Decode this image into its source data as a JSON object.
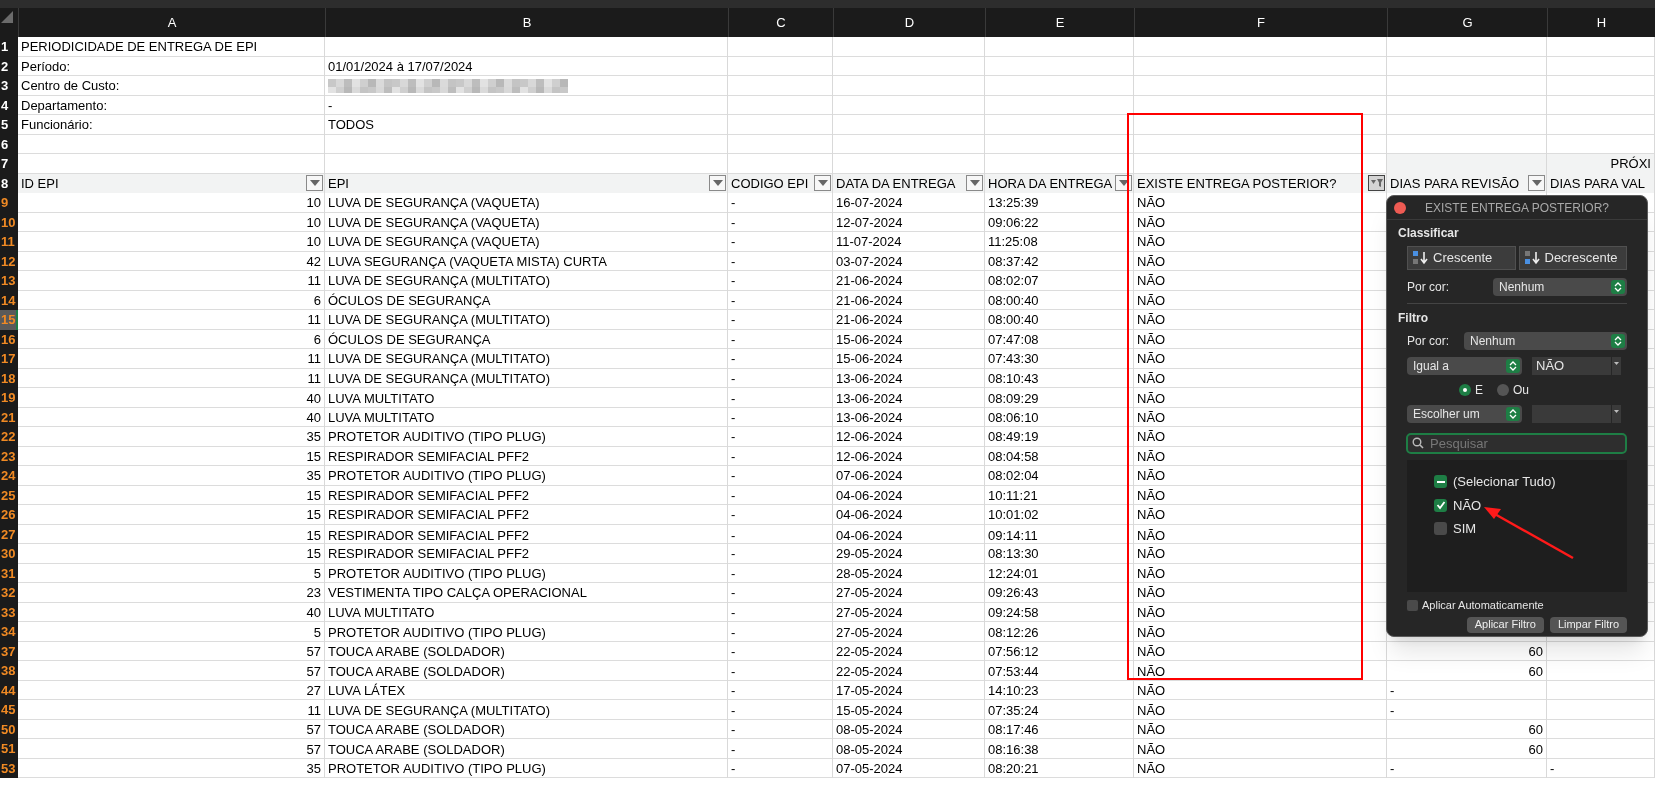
{
  "column_letters": [
    "A",
    "B",
    "C",
    "D",
    "E",
    "F",
    "G",
    "H"
  ],
  "report_rows": [
    {
      "number": "1",
      "filtered": false,
      "cells": [
        "PERIODICIDADE DE ENTREGA DE EPI"
      ]
    },
    {
      "number": "2",
      "filtered": false,
      "cells": [
        "Período:",
        "01/01/2024 à 17/07/2024"
      ]
    },
    {
      "number": "3",
      "filtered": false,
      "cells": [
        "Centro de Custo:"
      ],
      "redacted": true
    },
    {
      "number": "4",
      "filtered": false,
      "cells": [
        "Departamento:",
        "-"
      ]
    },
    {
      "number": "5",
      "filtered": false,
      "cells": [
        "Funcionário:",
        "TODOS"
      ]
    },
    {
      "number": "6",
      "filtered": false
    },
    {
      "number": "7",
      "filtered": false,
      "group_label": "PRÓXI"
    }
  ],
  "header_row": {
    "number": "8",
    "filtered": false,
    "headers": [
      {
        "label": "ID EPI",
        "filter_active": false
      },
      {
        "label": "EPI",
        "filter_active": false
      },
      {
        "label": "CODIGO EPI",
        "filter_active": false
      },
      {
        "label": "DATA DA ENTREGA",
        "filter_active": false
      },
      {
        "label": "HORA DA ENTREGA",
        "filter_active": false
      },
      {
        "label": "EXISTE ENTREGA POSTERIOR?",
        "filter_active": true
      },
      {
        "label": "DIAS PARA REVISÃO",
        "filter_active": false
      },
      {
        "label": "DIAS PARA VAL"
      }
    ]
  },
  "data_rows": [
    {
      "number": "9",
      "filtered": true,
      "selected": false,
      "hidden_below": false,
      "cells": [
        "10",
        "LUVA DE SEGURANÇA (VAQUETA)",
        "-",
        "16-07-2024",
        "13:25:39",
        "NÃO"
      ]
    },
    {
      "number": "10",
      "filtered": true,
      "selected": false,
      "hidden_below": false,
      "cells": [
        "10",
        "LUVA DE SEGURANÇA (VAQUETA)",
        "-",
        "12-07-2024",
        "09:06:22",
        "NÃO"
      ]
    },
    {
      "number": "11",
      "filtered": true,
      "selected": false,
      "hidden_below": false,
      "cells": [
        "10",
        "LUVA DE SEGURANÇA (VAQUETA)",
        "-",
        "11-07-2024",
        "11:25:08",
        "NÃO"
      ]
    },
    {
      "number": "12",
      "filtered": true,
      "selected": false,
      "hidden_below": false,
      "cells": [
        "42",
        "LUVA SEGURANÇA (VAQUETA MISTA) CURTA",
        "-",
        "03-07-2024",
        "08:37:42",
        "NÃO"
      ]
    },
    {
      "number": "13",
      "filtered": true,
      "selected": false,
      "hidden_below": false,
      "cells": [
        "11",
        "LUVA DE SEGURANÇA (MULTITATO)",
        "-",
        "21-06-2024",
        "08:02:07",
        "NÃO"
      ]
    },
    {
      "number": "14",
      "filtered": true,
      "selected": false,
      "hidden_below": false,
      "cells": [
        "6",
        "ÓCULOS DE SEGURANÇA",
        "-",
        "21-06-2024",
        "08:00:40",
        "NÃO"
      ]
    },
    {
      "number": "15",
      "filtered": true,
      "selected": true,
      "hidden_below": false,
      "cells": [
        "11",
        "LUVA DE SEGURANÇA (MULTITATO)",
        "-",
        "21-06-2024",
        "08:00:40",
        "NÃO"
      ]
    },
    {
      "number": "16",
      "filtered": true,
      "selected": false,
      "hidden_below": false,
      "cells": [
        "6",
        "ÓCULOS DE SEGURANÇA",
        "-",
        "15-06-2024",
        "07:47:08",
        "NÃO"
      ]
    },
    {
      "number": "17",
      "filtered": true,
      "selected": false,
      "hidden_below": false,
      "cells": [
        "11",
        "LUVA DE SEGURANÇA (MULTITATO)",
        "-",
        "15-06-2024",
        "07:43:30",
        "NÃO"
      ]
    },
    {
      "number": "18",
      "filtered": true,
      "selected": false,
      "hidden_below": false,
      "cells": [
        "11",
        "LUVA DE SEGURANÇA (MULTITATO)",
        "-",
        "13-06-2024",
        "08:10:43",
        "NÃO"
      ]
    },
    {
      "number": "19",
      "filtered": true,
      "selected": false,
      "hidden_below": true,
      "cells": [
        "40",
        "LUVA MULTITATO",
        "-",
        "13-06-2024",
        "08:09:29",
        "NÃO"
      ]
    },
    {
      "number": "21",
      "filtered": true,
      "selected": false,
      "hidden_below": false,
      "cells": [
        "40",
        "LUVA MULTITATO",
        "-",
        "13-06-2024",
        "08:06:10",
        "NÃO"
      ]
    },
    {
      "number": "22",
      "filtered": true,
      "selected": false,
      "hidden_below": false,
      "cells": [
        "35",
        "PROTETOR AUDITIVO (TIPO PLUG)",
        "-",
        "12-06-2024",
        "08:49:19",
        "NÃO"
      ]
    },
    {
      "number": "23",
      "filtered": true,
      "selected": false,
      "hidden_below": false,
      "cells": [
        "15",
        "RESPIRADOR SEMIFACIAL PFF2",
        "-",
        "12-06-2024",
        "08:04:58",
        "NÃO"
      ]
    },
    {
      "number": "24",
      "filtered": true,
      "selected": false,
      "hidden_below": false,
      "cells": [
        "35",
        "PROTETOR AUDITIVO (TIPO PLUG)",
        "-",
        "07-06-2024",
        "08:02:04",
        "NÃO"
      ]
    },
    {
      "number": "25",
      "filtered": true,
      "selected": false,
      "hidden_below": false,
      "cells": [
        "15",
        "RESPIRADOR SEMIFACIAL PFF2",
        "-",
        "04-06-2024",
        "10:11:21",
        "NÃO"
      ]
    },
    {
      "number": "26",
      "filtered": true,
      "selected": false,
      "hidden_below": false,
      "cells": [
        "15",
        "RESPIRADOR SEMIFACIAL PFF2",
        "-",
        "04-06-2024",
        "10:01:02",
        "NÃO"
      ]
    },
    {
      "number": "27",
      "filtered": true,
      "selected": false,
      "hidden_below": true,
      "cells": [
        "15",
        "RESPIRADOR SEMIFACIAL PFF2",
        "-",
        "04-06-2024",
        "09:14:11",
        "NÃO"
      ]
    },
    {
      "number": "30",
      "filtered": true,
      "selected": false,
      "hidden_below": false,
      "cells": [
        "15",
        "RESPIRADOR SEMIFACIAL PFF2",
        "-",
        "29-05-2024",
        "08:13:30",
        "NÃO"
      ]
    },
    {
      "number": "31",
      "filtered": true,
      "selected": false,
      "hidden_below": false,
      "cells": [
        "5",
        "PROTETOR AUDITIVO (TIPO PLUG)",
        "-",
        "28-05-2024",
        "12:24:01",
        "NÃO"
      ]
    },
    {
      "number": "32",
      "filtered": true,
      "selected": false,
      "hidden_below": false,
      "cells": [
        "23",
        "VESTIMENTA TIPO CALÇA OPERACIONAL",
        "-",
        "27-05-2024",
        "09:26:43",
        "NÃO"
      ]
    },
    {
      "number": "33",
      "filtered": true,
      "selected": false,
      "hidden_below": false,
      "cells": [
        "40",
        "LUVA MULTITATO",
        "-",
        "27-05-2024",
        "09:24:58",
        "NÃO"
      ]
    },
    {
      "number": "34",
      "filtered": true,
      "selected": false,
      "hidden_below": true,
      "cells": [
        "5",
        "PROTETOR AUDITIVO (TIPO PLUG)",
        "-",
        "27-05-2024",
        "08:12:26",
        "NÃO"
      ]
    },
    {
      "number": "37",
      "filtered": true,
      "selected": false,
      "hidden_below": false,
      "cells": [
        "57",
        "TOUCA ARABE (SOLDADOR)",
        "-",
        "22-05-2024",
        "07:56:12",
        "NÃO"
      ],
      "g": {
        "text": "60",
        "kind": "number"
      }
    },
    {
      "number": "38",
      "filtered": true,
      "selected": false,
      "hidden_below": true,
      "cells": [
        "57",
        "TOUCA ARABE (SOLDADOR)",
        "-",
        "22-05-2024",
        "07:53:44",
        "NÃO"
      ],
      "g": {
        "text": "60",
        "kind": "number"
      }
    },
    {
      "number": "44",
      "filtered": true,
      "selected": false,
      "hidden_below": false,
      "cells": [
        "27",
        "LUVA LÁTEX",
        "-",
        "17-05-2024",
        "14:10:23",
        "NÃO"
      ],
      "g": {
        "text": "-",
        "kind": "text"
      }
    },
    {
      "number": "45",
      "filtered": true,
      "selected": false,
      "hidden_below": true,
      "cells": [
        "11",
        "LUVA DE SEGURANÇA (MULTITATO)",
        "-",
        "15-05-2024",
        "07:35:24",
        "NÃO"
      ],
      "g": {
        "text": "-",
        "kind": "text"
      }
    },
    {
      "number": "50",
      "filtered": true,
      "selected": false,
      "hidden_below": false,
      "cells": [
        "57",
        "TOUCA ARABE (SOLDADOR)",
        "-",
        "08-05-2024",
        "08:17:46",
        "NÃO"
      ],
      "g": {
        "text": "60",
        "kind": "number"
      }
    },
    {
      "number": "51",
      "filtered": true,
      "selected": false,
      "hidden_below": true,
      "cells": [
        "57",
        "TOUCA ARABE (SOLDADOR)",
        "-",
        "08-05-2024",
        "08:16:38",
        "NÃO"
      ],
      "g": {
        "text": "60",
        "kind": "number"
      }
    },
    {
      "number": "53",
      "filtered": true,
      "selected": false,
      "hidden_below": false,
      "cells": [
        "35",
        "PROTETOR AUDITIVO (TIPO PLUG)",
        "-",
        "07-05-2024",
        "08:20:21",
        "NÃO"
      ],
      "g": {
        "text": "-",
        "kind": "text"
      },
      "h": {
        "text": "-",
        "kind": "text"
      }
    }
  ],
  "filter_popup": {
    "title": "EXISTE ENTREGA POSTERIOR?",
    "sort_heading": "Classificar",
    "sort_buttons": [
      {
        "label": "Crescente",
        "kind": "ascending"
      },
      {
        "label": "Decrescente",
        "kind": "descending"
      }
    ],
    "sort_by_color": {
      "label": "Por cor:",
      "value": "Nenhum"
    },
    "filter_heading": "Filtro",
    "filter_by_color": {
      "label": "Por cor:",
      "value": "Nenhum"
    },
    "condition_1": {
      "operator": "Igual a",
      "value": "NÃO"
    },
    "condition_2": {
      "operator": "Escolher um"
    },
    "join": [
      {
        "label": "E",
        "selected": true
      },
      {
        "label": "Ou",
        "selected": false
      }
    ],
    "search": {
      "placeholder": "Pesquisar"
    },
    "values": [
      {
        "label": "(Selecionar Tudo)",
        "checked": true,
        "mixed": true
      },
      {
        "label": "NÃO",
        "checked": true,
        "mixed": false
      },
      {
        "label": "SIM",
        "checked": false,
        "mixed": false
      }
    ],
    "auto_apply": {
      "label": "Aplicar Automaticamente",
      "checked": false
    },
    "buttons": [
      "Aplicar Filtro",
      "Limpar Filtro"
    ]
  },
  "annotations": {
    "highlight_rectangle": true,
    "arrow": true
  }
}
